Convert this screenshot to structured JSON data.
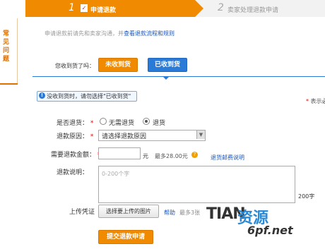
{
  "sidebar": {
    "label": "常见问题"
  },
  "steps": [
    {
      "number": "1",
      "label": "申请退款"
    },
    {
      "number": "2",
      "label": "卖家处理退款申请"
    }
  ],
  "notice": {
    "text": "申请退款前请先和卖家沟通，并",
    "link": "查看退款流程和规则"
  },
  "received": {
    "question": "您收到货了吗：",
    "not_received_button": "未收到货",
    "received_button": "已收到货"
  },
  "warning": {
    "icon": "info-icon",
    "text": "没收到货时，请勿选择\"已收到货\""
  },
  "required_note": "* 表示必",
  "form": {
    "return_goods": {
      "label": "是否退货：",
      "options": [
        "无需退货",
        "退货"
      ],
      "selected": "退货"
    },
    "reason": {
      "label": "退款原因：",
      "value": "请选择退款原因"
    },
    "amount": {
      "label": "需要退款金额：",
      "value": "",
      "unit": "元",
      "max_text": "最多28.00元",
      "link": "退货邮费说明"
    },
    "description": {
      "label": "退款说明：",
      "placeholder": "0-200个字",
      "limit": "200字"
    },
    "upload": {
      "label": "上传凭证",
      "button": "选择要上传的图片",
      "help": "帮助",
      "limit": "最多3张"
    },
    "submit_button": "提交退款申请"
  },
  "watermark": {
    "part1": "TIAN",
    "part2": "资源",
    "part3": "6pf.net"
  },
  "colors": {
    "accent": "#f08a00",
    "blue": "#2a7ad8",
    "link": "#1a55b8",
    "required": "#e00000"
  }
}
